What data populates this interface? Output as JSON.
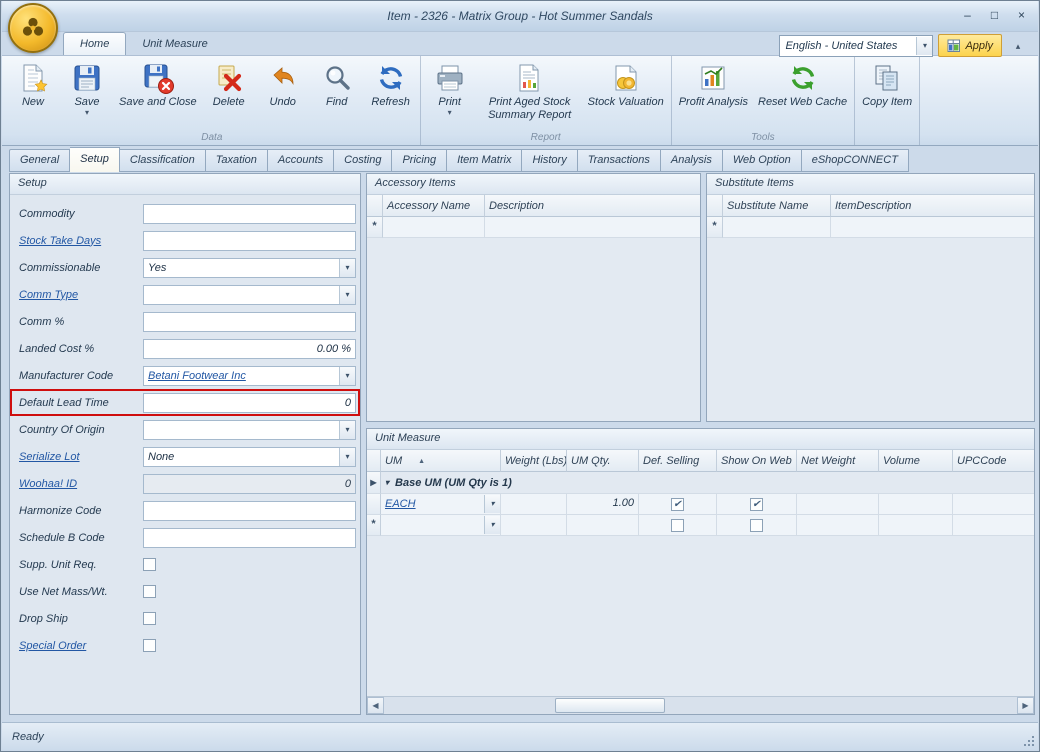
{
  "window": {
    "title": "Item - 2326 - Matrix Group - Hot Summer Sandals",
    "status": "Ready"
  },
  "ribbon": {
    "tabs": [
      {
        "label": "Home",
        "active": true
      },
      {
        "label": "Unit Measure",
        "active": false
      }
    ],
    "language_selector": {
      "value": "English - United States"
    },
    "apply_button": {
      "label": "Apply"
    },
    "groups": [
      {
        "label": "Data",
        "buttons": [
          {
            "label": "New",
            "icon": "new-document-icon"
          },
          {
            "label": "Save",
            "icon": "save-icon",
            "has_dropdown": true
          },
          {
            "label": "Save and Close",
            "icon": "save-close-icon"
          },
          {
            "label": "Delete",
            "icon": "delete-icon"
          },
          {
            "label": "Undo",
            "icon": "undo-icon"
          },
          {
            "label": "Find",
            "icon": "find-icon"
          },
          {
            "label": "Refresh",
            "icon": "refresh-icon"
          }
        ]
      },
      {
        "label": "Report",
        "buttons": [
          {
            "label": "Print",
            "icon": "print-icon",
            "has_dropdown": true
          },
          {
            "label": "Print Aged Stock Summary Report",
            "icon": "report-icon"
          },
          {
            "label": "Stock Valuation",
            "icon": "stock-valuation-icon"
          }
        ]
      },
      {
        "label": "Tools",
        "buttons": [
          {
            "label": "Profit Analysis",
            "icon": "profit-analysis-icon"
          },
          {
            "label": "Reset Web Cache",
            "icon": "reset-cache-icon"
          }
        ]
      },
      {
        "label": "",
        "buttons": [
          {
            "label": "Copy Item",
            "icon": "copy-item-icon"
          }
        ]
      }
    ]
  },
  "page_tabs": [
    {
      "label": "General",
      "active": false
    },
    {
      "label": "Setup",
      "active": true
    },
    {
      "label": "Classification",
      "active": false
    },
    {
      "label": "Taxation",
      "active": false
    },
    {
      "label": "Accounts",
      "active": false
    },
    {
      "label": "Costing",
      "active": false
    },
    {
      "label": "Pricing",
      "active": false
    },
    {
      "label": "Item Matrix",
      "active": false
    },
    {
      "label": "History",
      "active": false
    },
    {
      "label": "Transactions",
      "active": false
    },
    {
      "label": "Analysis",
      "active": false
    },
    {
      "label": "Web Option",
      "active": false
    },
    {
      "label": "eShopCONNECT",
      "active": false
    }
  ],
  "setup_panel": {
    "title": "Setup",
    "fields": [
      {
        "label": "Commodity",
        "type": "text",
        "value": ""
      },
      {
        "label": "Stock Take Days",
        "type": "text",
        "value": "",
        "link": true
      },
      {
        "label": "Commissionable",
        "type": "dropdown",
        "value": "Yes"
      },
      {
        "label": "Comm Type",
        "type": "dropdown",
        "value": "",
        "link": true
      },
      {
        "label": "Comm %",
        "type": "text",
        "value": ""
      },
      {
        "label": "Landed Cost %",
        "type": "text",
        "value": "0.00 %",
        "align": "right"
      },
      {
        "label": "Manufacturer Code",
        "type": "dropdown",
        "value": "Betani Footwear Inc",
        "value_link": true
      },
      {
        "label": "Default Lead Time",
        "type": "text",
        "value": "0",
        "align": "right",
        "highlighted": true
      },
      {
        "label": "Country Of Origin",
        "type": "dropdown",
        "value": ""
      },
      {
        "label": "Serialize Lot",
        "type": "dropdown",
        "value": "None",
        "link": true
      },
      {
        "label": "Woohaa! ID",
        "type": "text",
        "value": "0",
        "align": "right",
        "link": true,
        "disabled": true
      },
      {
        "label": "Harmonize Code",
        "type": "text",
        "value": ""
      },
      {
        "label": "Schedule B Code",
        "type": "text",
        "value": ""
      },
      {
        "label": "Supp. Unit Req.",
        "type": "checkbox",
        "checked": false
      },
      {
        "label": "Use Net Mass/Wt.",
        "type": "checkbox",
        "checked": false
      },
      {
        "label": "Drop Ship",
        "type": "checkbox",
        "checked": false
      },
      {
        "label": "Special Order",
        "type": "checkbox",
        "checked": false,
        "link": true
      }
    ]
  },
  "accessory_items": {
    "title": "Accessory Items",
    "columns": [
      "Accessory Name",
      "Description"
    ],
    "new_row_marker": "*"
  },
  "substitute_items": {
    "title": "Substitute Items",
    "columns": [
      "Substitute Name",
      "ItemDescription"
    ],
    "new_row_marker": "*"
  },
  "unit_measure": {
    "title": "Unit Measure",
    "columns": [
      "UM",
      "Weight (Lbs)",
      "UM Qty.",
      "Def. Selling",
      "Show On Web",
      "Net Weight",
      "Volume",
      "UPCCode"
    ],
    "sort": {
      "column": "UM",
      "direction": "asc"
    },
    "group_row": "Base UM (UM Qty is 1)",
    "rows": [
      {
        "um": "EACH",
        "weight_lbs": "",
        "um_qty": "1.00",
        "def_selling": true,
        "show_on_web": true,
        "net_weight": "",
        "volume": "",
        "upc_code": ""
      }
    ],
    "new_row_marker": "*"
  }
}
